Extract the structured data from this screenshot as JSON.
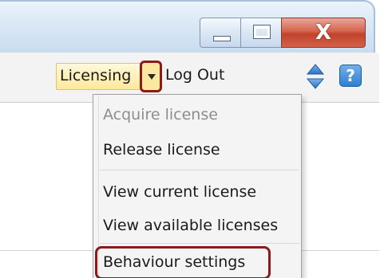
{
  "window": {
    "buttons": {
      "close_glyph": "X"
    }
  },
  "toolbar": {
    "licensing_label": "Licensing",
    "logout_label": "Log Out",
    "help_glyph": "?"
  },
  "menu": {
    "items": [
      {
        "label": "Acquire license",
        "enabled": false
      },
      {
        "label": "Release license",
        "enabled": true
      },
      {
        "label": "View current license",
        "enabled": true
      },
      {
        "label": "View available licenses",
        "enabled": true
      },
      {
        "label": "Behaviour settings",
        "enabled": true,
        "highlighted": true
      }
    ]
  },
  "colors": {
    "highlight": "#8b1a1a",
    "licensing_bg": "#fde99a",
    "disabled_text": "#8d8d8d"
  },
  "icons": [
    "sort-up-down-icon",
    "help-icon",
    "dropdown-arrow-icon",
    "minimize-icon",
    "maximize-icon",
    "close-icon"
  ]
}
